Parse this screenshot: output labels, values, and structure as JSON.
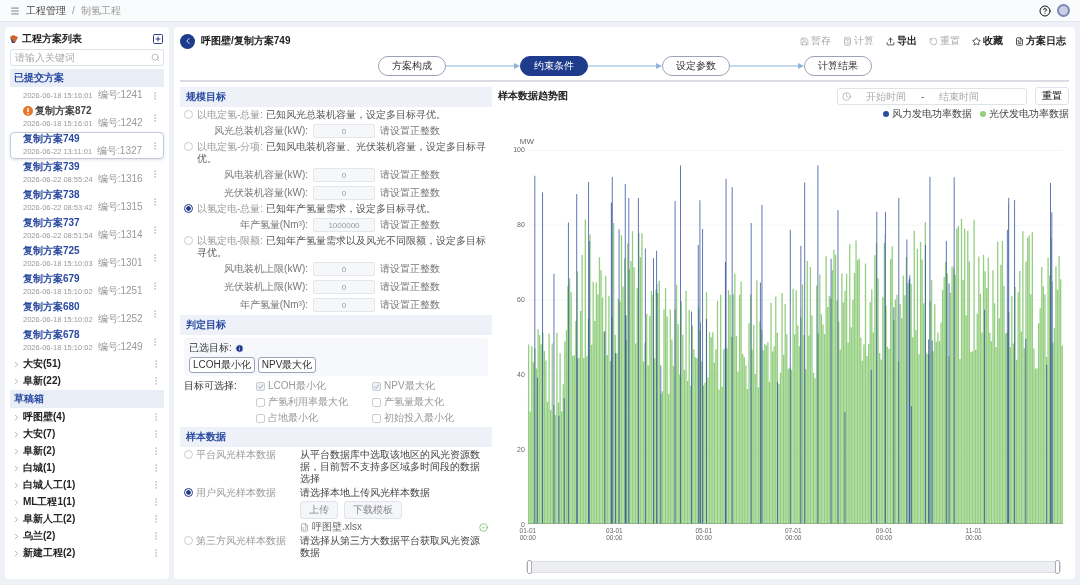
{
  "topbar": {
    "breadcrumb": [
      "工程管理",
      "制氢工程"
    ],
    "separator": "/"
  },
  "sidebar": {
    "title": "工程方案列表",
    "search": {
      "placeholder": "请输入关键词"
    },
    "sections": [
      {
        "title": "已提交方案",
        "items": [
          {
            "kind": "scheme",
            "date": "2026-06-18 15:16:01",
            "code": "编号:1241",
            "selected": false,
            "warning": false
          },
          {
            "kind": "scheme",
            "name": "复制方案872",
            "date": "2026-06-18 15:16:01",
            "code": "编号:1242",
            "selected": false,
            "warning": true
          },
          {
            "kind": "scheme",
            "name": "复制方案749",
            "date": "2026-06-22 13:11:01",
            "code": "编号:1327",
            "selected": true,
            "warning": false
          },
          {
            "kind": "scheme",
            "name": "复制方案739",
            "date": "2026-06-22 08:55:24",
            "code": "编号:1316",
            "selected": false,
            "warning": false
          },
          {
            "kind": "scheme",
            "name": "复制方案738",
            "date": "2026-06-22 08:53:42",
            "code": "编号:1315",
            "selected": false,
            "warning": false
          },
          {
            "kind": "scheme",
            "name": "复制方案737",
            "date": "2026-06-22 08:51:54",
            "code": "编号:1314",
            "selected": false,
            "warning": false
          },
          {
            "kind": "scheme",
            "name": "复制方案725",
            "date": "2026-06-18 15:10:03",
            "code": "编号:1301",
            "selected": false,
            "warning": false
          },
          {
            "kind": "scheme",
            "name": "复制方案679",
            "date": "2026-06-18 15:10:02",
            "code": "编号:1251",
            "selected": false,
            "warning": false
          },
          {
            "kind": "scheme",
            "name": "复制方案680",
            "date": "2026-06-18 15:10:02",
            "code": "编号:1252",
            "selected": false,
            "warning": false
          },
          {
            "kind": "scheme",
            "name": "复制方案678",
            "date": "2026-06-18 15:10:02",
            "code": "编号:1249",
            "selected": false,
            "warning": false
          },
          {
            "kind": "group",
            "label": "大安(51)",
            "expanded": false
          },
          {
            "kind": "group",
            "label": "阜新(22)",
            "expanded": false
          }
        ]
      },
      {
        "title": "草稿箱",
        "items": [
          {
            "kind": "group",
            "label": "呼图壁(4)",
            "expanded": false
          },
          {
            "kind": "group",
            "label": "大安(7)",
            "expanded": false
          },
          {
            "kind": "group",
            "label": "阜新(2)",
            "expanded": false
          },
          {
            "kind": "group",
            "label": "白城(1)",
            "expanded": false
          },
          {
            "kind": "group",
            "label": "白城人工(1)",
            "expanded": false
          },
          {
            "kind": "group",
            "label": "ML工程1(1)",
            "expanded": false
          },
          {
            "kind": "group",
            "label": "阜新人工(2)",
            "expanded": false
          },
          {
            "kind": "group",
            "label": "乌兰(2)",
            "expanded": false
          },
          {
            "kind": "group",
            "label": "新建工程(2)",
            "expanded": false
          }
        ]
      }
    ]
  },
  "header": {
    "title": "呼图壁/复制方案749",
    "actions": [
      {
        "label": "暂存",
        "disabled": true
      },
      {
        "label": "计算",
        "disabled": true
      },
      {
        "label": "导出",
        "disabled": false
      },
      {
        "label": "重置",
        "disabled": true
      },
      {
        "label": "收藏",
        "disabled": false
      },
      {
        "label": "方案日志",
        "disabled": false
      }
    ]
  },
  "steps": [
    {
      "label": "方案构成",
      "selected": false
    },
    {
      "label": "约束条件",
      "selected": true
    },
    {
      "label": "设定参数",
      "selected": false
    },
    {
      "label": "计算结果",
      "selected": false
    }
  ],
  "constraints": {
    "scale": {
      "title": "规模目标",
      "options": [
        {
          "label": "以电定氢-总量:",
          "desc": "已知风光总装机容量，设定多目标寻优。",
          "selected": false,
          "fields": [
            {
              "label": "风光总装机容量(kW):",
              "value": "0",
              "hint": "请设置正整数"
            }
          ]
        },
        {
          "label": "以电定氢-分项:",
          "desc": "已知风电装机容量、光伏装机容量，设定多目标寻优。",
          "selected": false,
          "fields": [
            {
              "label": "风电装机容量(kW):",
              "value": "0",
              "hint": "请设置正整数"
            },
            {
              "label": "光伏装机容量(kW):",
              "value": "0",
              "hint": "请设置正整数"
            }
          ]
        },
        {
          "label": "以氢定电-总量:",
          "desc": "已知年产氢量需求，设定多目标寻优。",
          "selected": true,
          "fields": [
            {
              "label": "年产氢量(Nm³):",
              "value": "1000000",
              "hint": "请设置正整数"
            }
          ]
        },
        {
          "label": "以氢定电-限额:",
          "desc": "已知年产氢量需求以及风光不同限额，设定多目标寻优。",
          "selected": false,
          "fields": [
            {
              "label": "风电装机上限(kW):",
              "value": "0",
              "hint": "请设置正整数"
            },
            {
              "label": "光伏装机上限(kW):",
              "value": "0",
              "hint": "请设置正整数"
            },
            {
              "label": "年产氢量(Nm³):",
              "value": "0",
              "hint": "请设置正整数"
            }
          ]
        }
      ]
    },
    "objectives": {
      "title": "判定目标",
      "selected_label": "已选目标:",
      "tags": [
        "LCOH最小化",
        "NPV最大化"
      ],
      "choices_label": "目标可选择:",
      "choices": [
        {
          "label": "LCOH最小化",
          "checked": true
        },
        {
          "label": "NPV最大化",
          "checked": true
        },
        {
          "label": "产氢利用率最大化",
          "checked": false
        },
        {
          "label": "产氢量最大化",
          "checked": false
        },
        {
          "label": "占地最小化",
          "checked": false
        },
        {
          "label": "初始投入最小化",
          "checked": false
        }
      ]
    },
    "samples": {
      "title": "样本数据",
      "options": [
        {
          "label": "平台风光样本数据",
          "desc": "从平台数据库中选取该地区的风光资源数据，目前暂不支持多区域多时间段的数据选择",
          "selected": false
        },
        {
          "label": "用户风光样本数据",
          "desc": "请选择本地上传风光样本数据",
          "selected": true,
          "buttons": [
            "上传",
            "下载模板"
          ],
          "file": "呼图壁.xlsx"
        },
        {
          "label": "第三方风光样本数据",
          "desc": "请选择从第三方大数据平台获取风光资源数据",
          "selected": false
        }
      ]
    }
  },
  "chart": {
    "title": "样本数据趋势图",
    "start_placeholder": "开始时间",
    "range_separator": "-",
    "end_placeholder": "结束时间",
    "reset": "重置",
    "legend": [
      {
        "name": "风力发电功率数据",
        "color": "#2e4d9c"
      },
      {
        "name": "光伏发电功率数据",
        "color": "#93cf7f"
      }
    ],
    "unit": "MW",
    "y_ticks": [
      "100",
      "80",
      "60",
      "40",
      "20",
      "0"
    ],
    "zoom": {
      "level": 1
    },
    "x_ticks": [
      {
        "date": "01-01",
        "time": "00:00"
      },
      {
        "date": "03-01",
        "time": "00:00"
      },
      {
        "date": "05-01",
        "time": "00:00"
      },
      {
        "date": "07-01",
        "time": "00:00"
      },
      {
        "date": "09-01",
        "time": "00:00"
      },
      {
        "date": "11-01",
        "time": "00:00"
      }
    ]
  }
}
